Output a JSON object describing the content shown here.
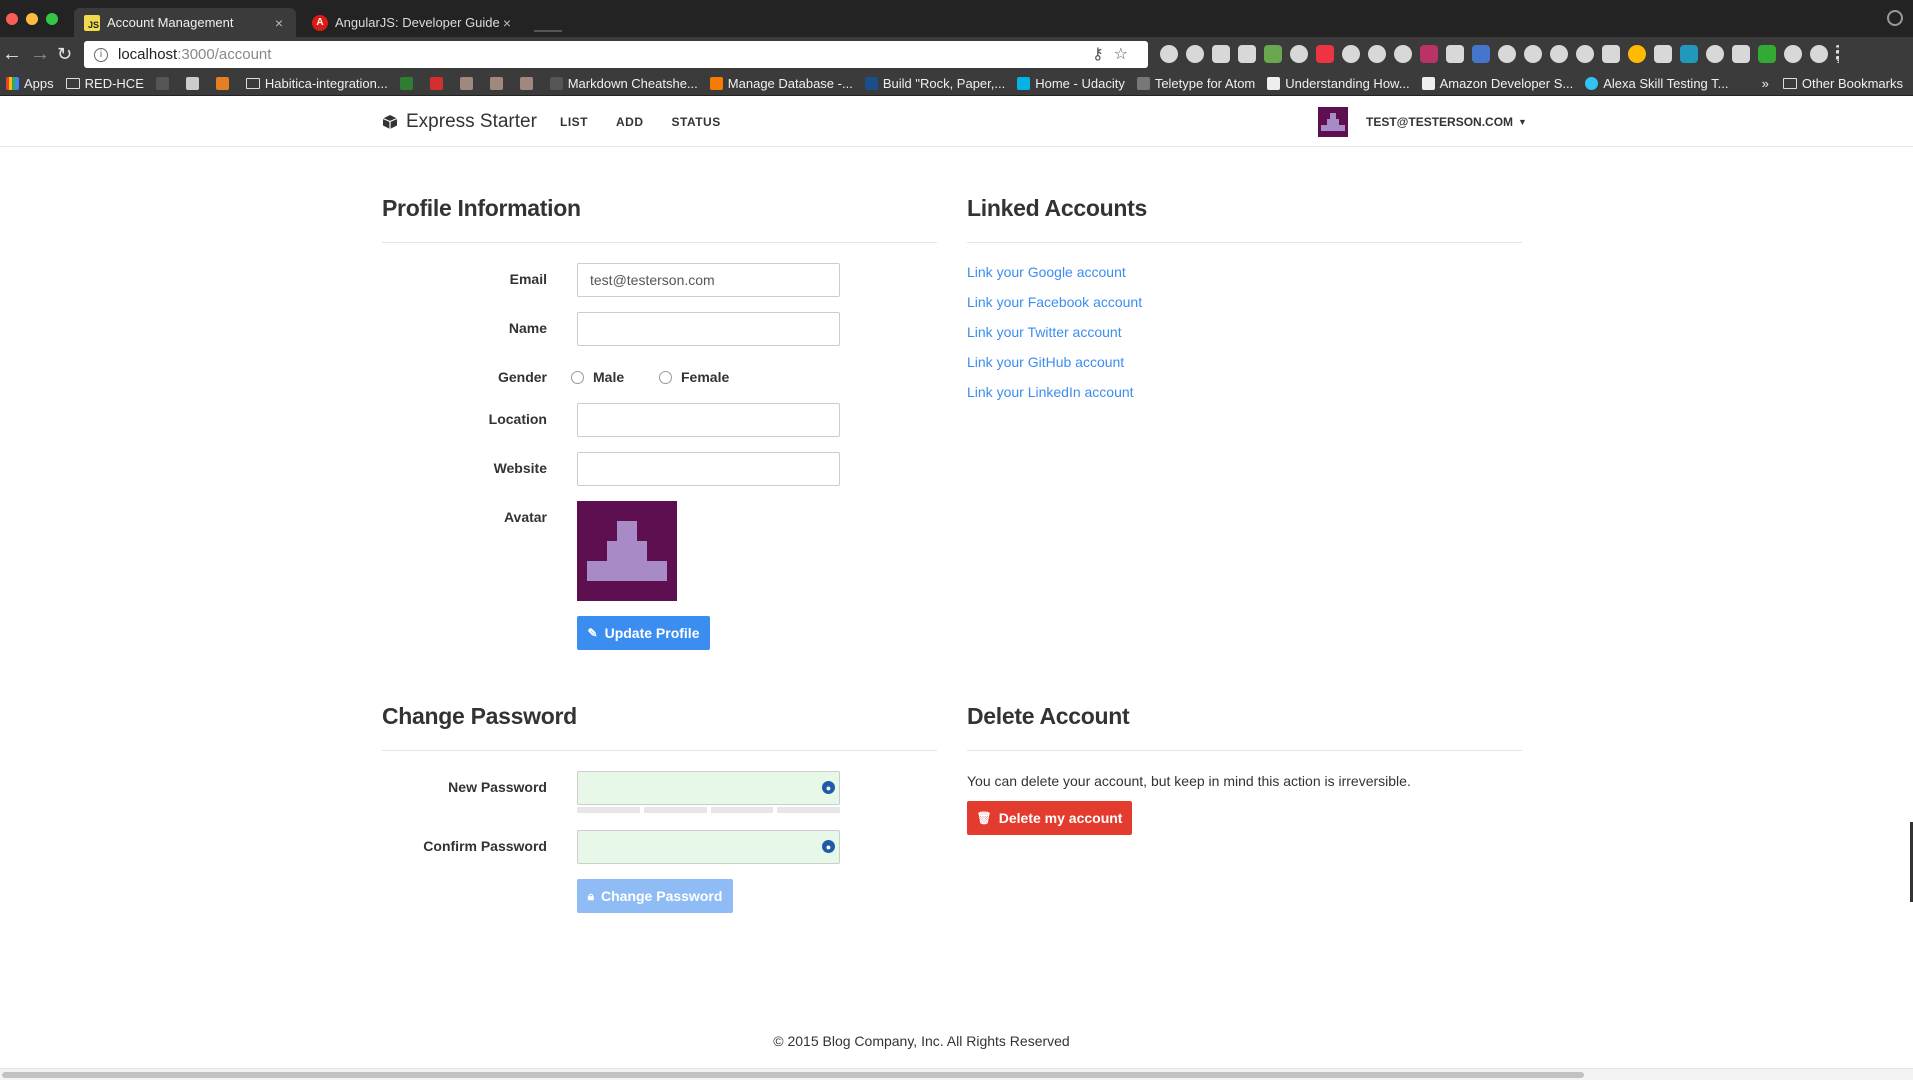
{
  "browser": {
    "tabs": [
      {
        "title": "Account Management",
        "icon": "js-favicon",
        "active": true
      },
      {
        "title": "AngularJS: Developer Guide: F",
        "icon": "angular-favicon",
        "active": false
      }
    ],
    "url_host": "localhost",
    "url_rest": ":3000/account",
    "bookmarks": [
      "Apps",
      "RED-HCE",
      "Habitica-integration...",
      "Markdown Cheatshe...",
      "Manage Database -...",
      "Build \"Rock, Paper,...",
      "Home - Udacity",
      "Teletype for Atom",
      "Understanding How...",
      "Amazon Developer S...",
      "Alexa Skill Testing T..."
    ],
    "other_bookmarks": "Other Bookmarks",
    "overflow": "»"
  },
  "navbar": {
    "brand": "Express Starter",
    "links": [
      "LIST",
      "ADD",
      "STATUS"
    ],
    "user": "TEST@TESTERSON.COM"
  },
  "profile": {
    "title": "Profile Information",
    "email_label": "Email",
    "email_value": "test@testerson.com",
    "name_label": "Name",
    "name_value": "",
    "gender_label": "Gender",
    "gender_options": [
      "Male",
      "Female"
    ],
    "location_label": "Location",
    "location_value": "",
    "website_label": "Website",
    "website_value": "",
    "avatar_label": "Avatar",
    "update_button": "Update Profile"
  },
  "linked": {
    "title": "Linked Accounts",
    "links": [
      "Link your Google account",
      "Link your Facebook account",
      "Link your Twitter account",
      "Link your GitHub account",
      "Link your LinkedIn account"
    ]
  },
  "password": {
    "title": "Change Password",
    "new_label": "New Password",
    "confirm_label": "Confirm Password",
    "button": "Change Password",
    "strength_segments": 4
  },
  "delete": {
    "title": "Delete Account",
    "message": "You can delete your account, but keep in mind this action is irreversible.",
    "button": "Delete my account"
  },
  "footer": "© 2015 Blog Company, Inc. All Rights Reserved",
  "colors": {
    "primary": "#3c8df0",
    "danger": "#e33b2e",
    "avatar_bg": "#5e0f4f",
    "avatar_fg": "#a88bc6"
  }
}
